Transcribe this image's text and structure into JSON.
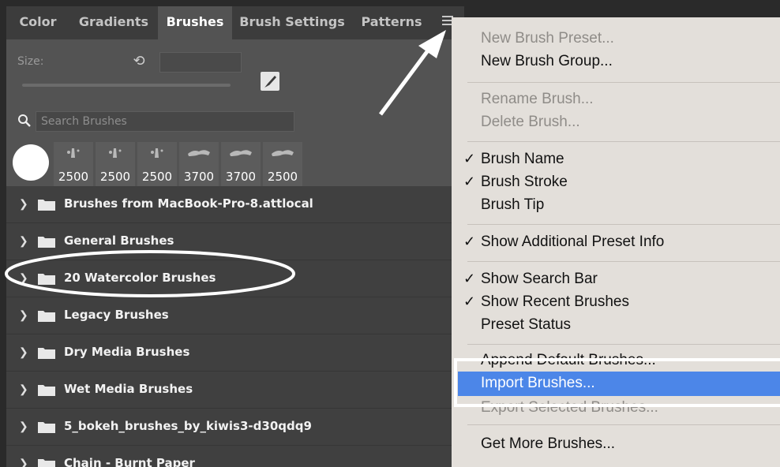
{
  "tabs": [
    {
      "label": "Color",
      "active": false
    },
    {
      "label": "Gradients",
      "active": false
    },
    {
      "label": "Brushes",
      "active": true
    },
    {
      "label": "Brush Settings",
      "active": false
    },
    {
      "label": "Patterns",
      "active": false
    }
  ],
  "size": {
    "label": "Size:",
    "value": ""
  },
  "search": {
    "placeholder": "Search Brushes"
  },
  "recent_brushes": [
    "2500",
    "2500",
    "2500",
    "3700",
    "3700",
    "2500"
  ],
  "groups": [
    "Brushes from MacBook-Pro-8.attlocal",
    "General Brushes",
    "20 Watercolor  Brushes",
    "Legacy Brushes",
    "Dry Media Brushes",
    "Wet Media Brushes",
    "5_bokeh_brushes_by_kiwis3-d30qdq9",
    "Chain - Burnt Paper"
  ],
  "menu": {
    "new_preset": "New Brush Preset...",
    "new_group": "New Brush Group...",
    "rename": "Rename Brush...",
    "delete": "Delete Brush...",
    "brush_name": "Brush Name",
    "brush_stroke": "Brush Stroke",
    "brush_tip": "Brush Tip",
    "additional_info": "Show Additional Preset Info",
    "search_bar": "Show Search Bar",
    "recent": "Show Recent Brushes",
    "preset_status": "Preset Status",
    "append": "Append Default Brushes...",
    "import": "Import Brushes...",
    "export": "Export Selected Brushes...",
    "get_more": "Get More Brushes...",
    "checkmark": "✓"
  },
  "colors": {
    "highlight": "#4c86e8",
    "menu_bg": "#e3dfda",
    "panel_bg": "#535353"
  }
}
